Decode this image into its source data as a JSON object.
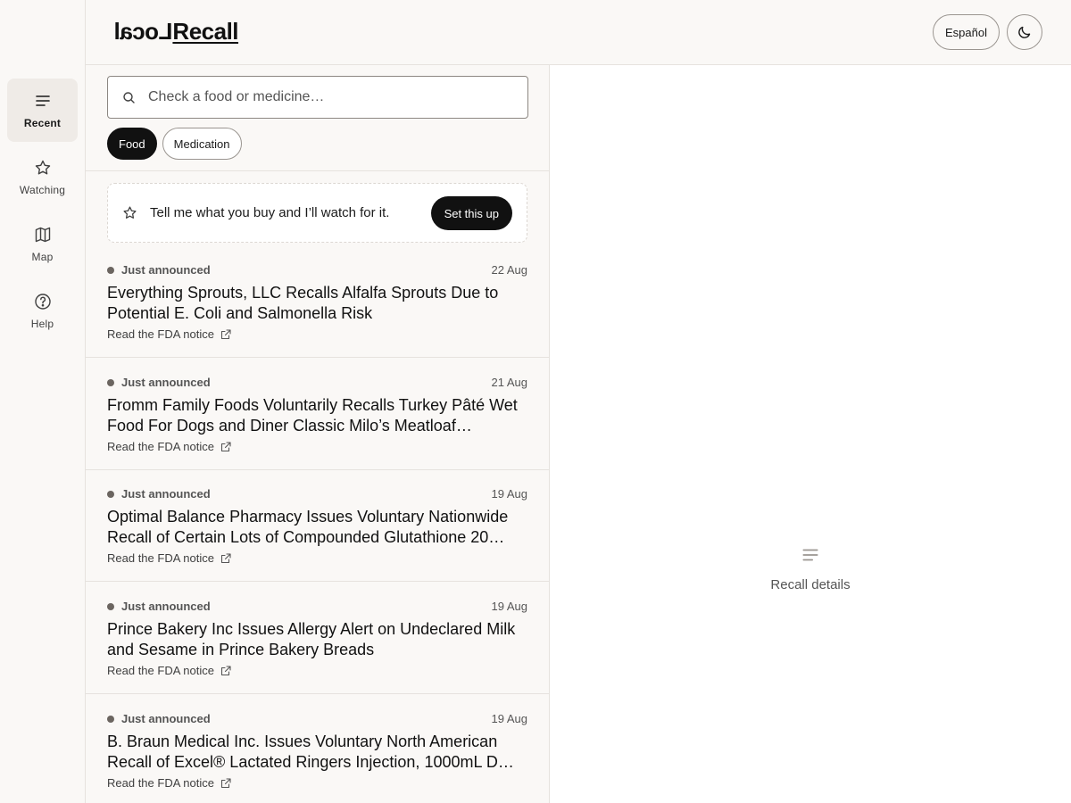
{
  "app": {
    "logo_mirrored": "Local",
    "logo_text": "Recall"
  },
  "header": {
    "language_label": "Español",
    "theme_icon": "moon-icon"
  },
  "sidebar": {
    "items": [
      {
        "label": "Recent",
        "icon": "lines-icon",
        "active": true
      },
      {
        "label": "Watching",
        "icon": "star-icon",
        "active": false
      },
      {
        "label": "Map",
        "icon": "map-icon",
        "active": false
      },
      {
        "label": "Help",
        "icon": "help-circle-icon",
        "active": false
      }
    ]
  },
  "search": {
    "placeholder": "Check a food or medicine…",
    "value": ""
  },
  "filters": [
    {
      "label": "Food",
      "active": true
    },
    {
      "label": "Medication",
      "active": false
    }
  ],
  "watch_prompt": {
    "text": "Tell me what you buy and I’ll watch for it.",
    "button_label": "Set this up"
  },
  "recalls": [
    {
      "status": "Just announced",
      "date": "22 Aug",
      "title": "Everything Sprouts, LLC Recalls Alfalfa Sprouts Due to Potential E. Coli and Salmonella Risk",
      "link_label": "Read the FDA notice"
    },
    {
      "status": "Just announced",
      "date": "21 Aug",
      "title": "Fromm Family Foods Voluntarily Recalls Turkey Pâté Wet Food For Dogs and Diner Classic Milo’s Meatloaf…",
      "link_label": "Read the FDA notice"
    },
    {
      "status": "Just announced",
      "date": "19 Aug",
      "title": "Optimal Balance Pharmacy Issues Voluntary Nationwide Recall of Certain Lots of Compounded Glutathione 20…",
      "link_label": "Read the FDA notice"
    },
    {
      "status": "Just announced",
      "date": "19 Aug",
      "title": "Prince Bakery Inc Issues Allergy Alert on Undeclared Milk and Sesame in Prince Bakery Breads",
      "link_label": "Read the FDA notice"
    },
    {
      "status": "Just announced",
      "date": "19 Aug",
      "title": "B. Braun Medical Inc. Issues Voluntary North American Recall of Excel® Lactated Ringers Injection, 1000mL D…",
      "link_label": "Read the FDA notice"
    }
  ],
  "detail": {
    "empty_label": "Recall details",
    "icon": "lines-icon"
  }
}
